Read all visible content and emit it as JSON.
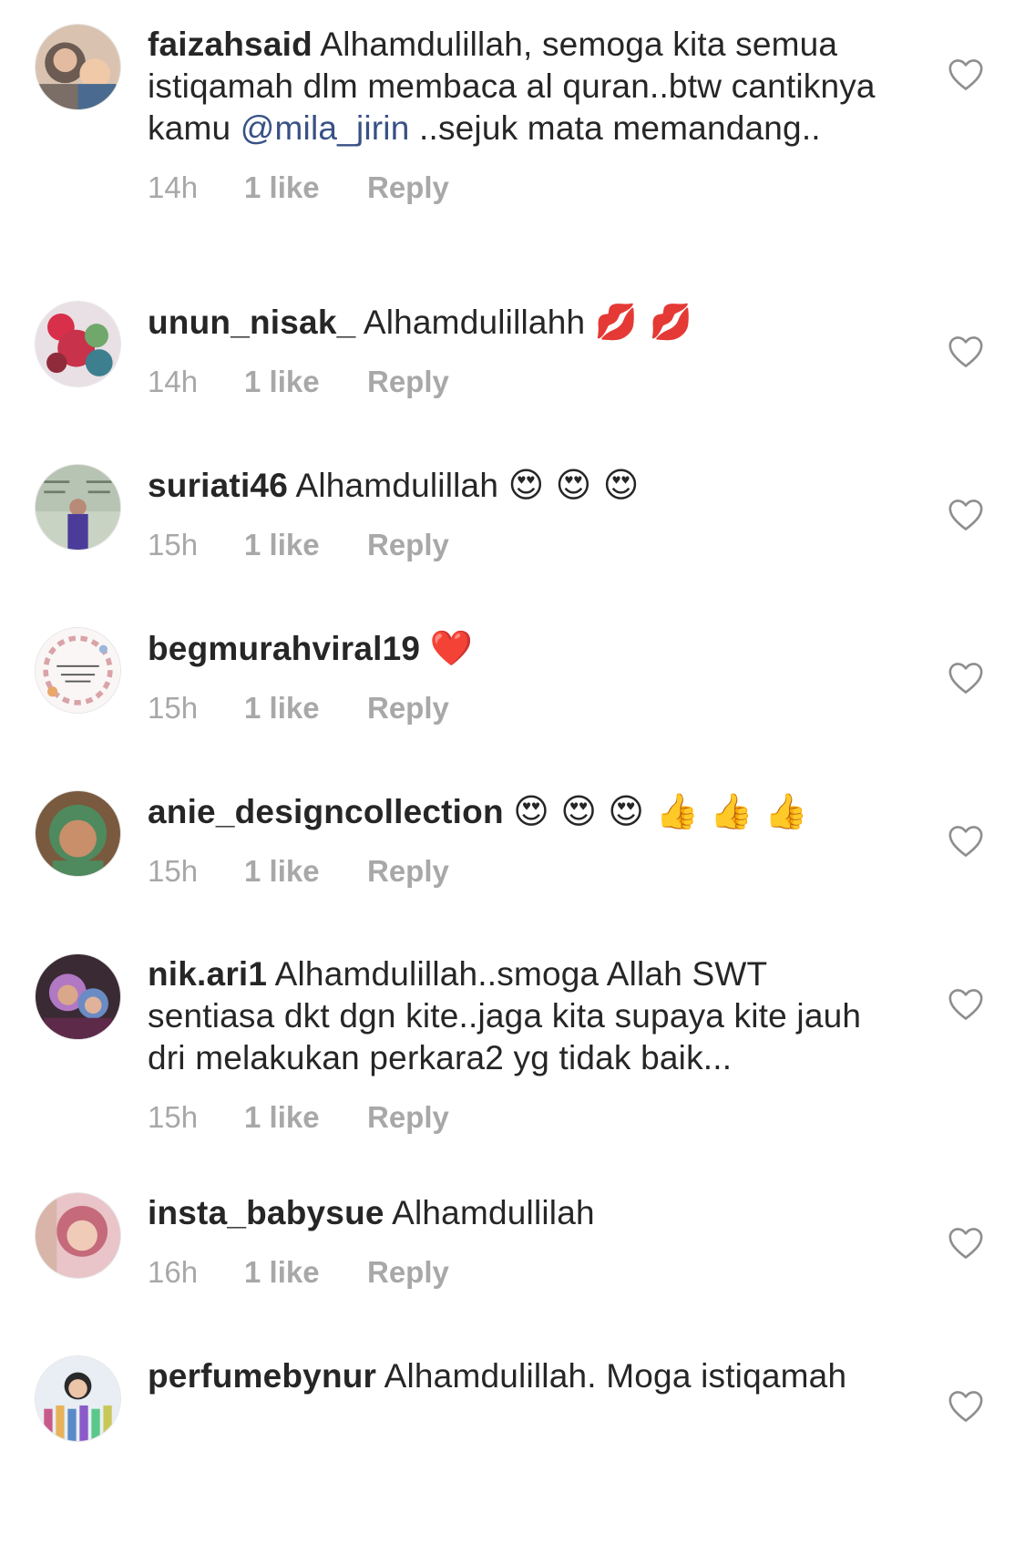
{
  "comments": [
    {
      "username": "faizahsaid",
      "text_before": " Alhamdulillah, semoga kita semua istiqamah dlm membaca al quran..btw cantiknya kamu ",
      "mention": "@mila_jirin",
      "text_after": " ..sejuk mata memandang..",
      "time": "14h",
      "likes": "1 like",
      "reply": "Reply",
      "avatar_color": "#b58a6e"
    },
    {
      "username": "unun_nisak_",
      "text_before": " Alhamdulillahh ",
      "emojis": "💋 💋",
      "time": "14h",
      "likes": "1 like",
      "reply": "Reply",
      "avatar_color": "#c8324a"
    },
    {
      "username": "suriati46",
      "text_before": " Alhamdulillah ",
      "emojis": "😍 😍 😍",
      "time": "15h",
      "likes": "1 like",
      "reply": "Reply",
      "avatar_color": "#9fb5a0"
    },
    {
      "username": "begmurahviral19",
      "text_before": " ",
      "emojis": "❤️",
      "time": "15h",
      "likes": "1 like",
      "reply": "Reply",
      "avatar_color": "#f3ecec"
    },
    {
      "username": "anie_designcollection",
      "text_before": " ",
      "emojis": "😍 😍 😍 👍 👍 👍",
      "time": "15h",
      "likes": "1 like",
      "reply": "Reply",
      "avatar_color": "#5f8a5a"
    },
    {
      "username": "nik.ari1",
      "text_before": " Alhamdulillah..smoga Allah SWT sentiasa dkt dgn kite..jaga kita supaya kite jauh dri melakukan perkara2 yg tidak baik...",
      "time": "15h",
      "likes": "1 like",
      "reply": "Reply",
      "avatar_color": "#7a4a6e"
    },
    {
      "username": "insta_babysue",
      "text_before": " Alhamdullilah",
      "time": "16h",
      "likes": "1 like",
      "reply": "Reply",
      "avatar_color": "#d89aa0"
    },
    {
      "username": "perfumebynur",
      "text_before": " Alhamdulillah. Moga istiqamah",
      "avatar_color": "#3d5570"
    }
  ],
  "colors": {
    "text": "#262626",
    "meta": "#a8a8a8",
    "mention": "#385185",
    "heart_outline": "#8e8e8e"
  }
}
